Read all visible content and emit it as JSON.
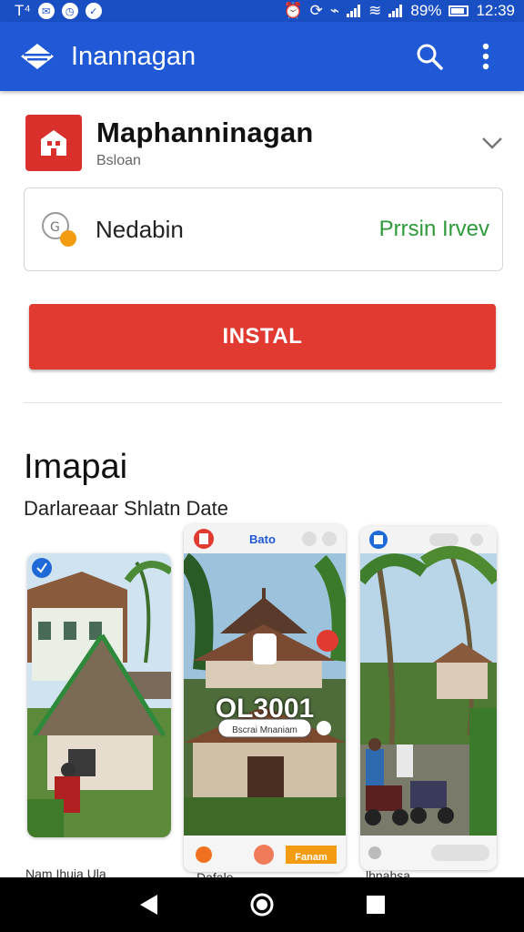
{
  "status_bar": {
    "left_text": "T⁴",
    "battery": "89%",
    "time": "12:39"
  },
  "app_bar": {
    "title": "Inannagan",
    "logo_icon": "diamond-logo-icon",
    "search_icon": "search-icon",
    "menu_icon": "more-vert-icon"
  },
  "app": {
    "name": "Maphanninagan",
    "subtitle": "Bsloan",
    "icon": "app-icon"
  },
  "info_card": {
    "label": "Nedabin",
    "link": "Prrsin Irvev"
  },
  "install_label": "INSTAL",
  "section": {
    "title": "Imapai",
    "subtitle": "Darlareaar Shlatn Date"
  },
  "screenshots": [
    {
      "caption": "Nam Ihuia Ula"
    },
    {
      "header": "Bato",
      "overlay_big": "OL3001",
      "overlay_small": "Bscrai Mnaniam",
      "button": "Fanam",
      "caption": "Dafalo"
    },
    {
      "caption": "lhnahsa"
    }
  ],
  "colors": {
    "status_bar": "#1a4fc4",
    "app_bar": "#1f59d6",
    "install": "#e03a31",
    "link": "#2e9a3a"
  }
}
